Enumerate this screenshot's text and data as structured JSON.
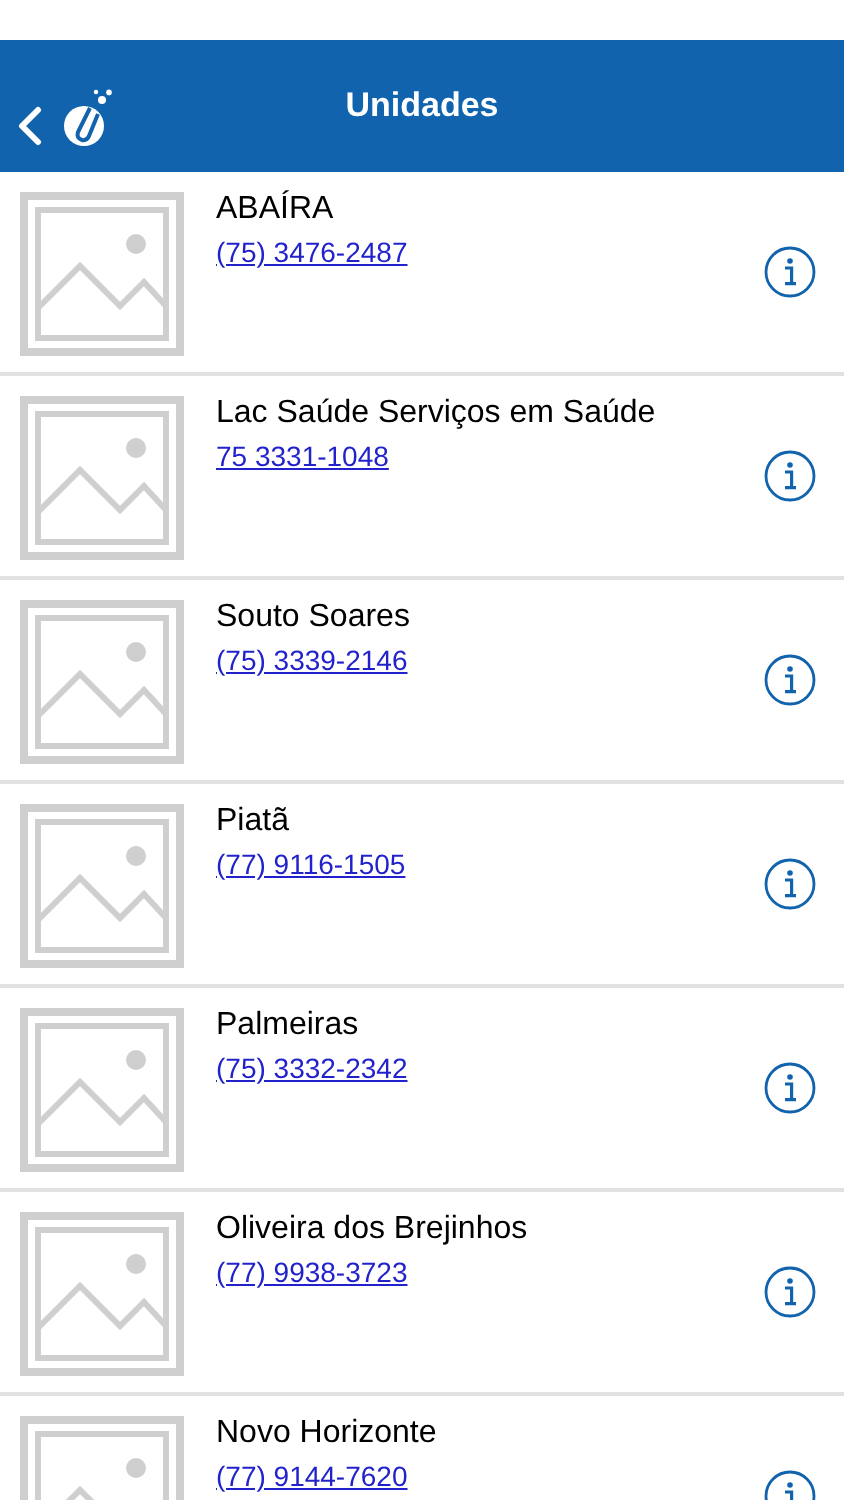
{
  "header": {
    "title": "Unidades"
  },
  "units": [
    {
      "name": "ABAÍRA",
      "phone": "(75) 3476-2487"
    },
    {
      "name": "Lac Saúde Serviços em Saúde",
      "phone": "75 3331-1048"
    },
    {
      "name": "Souto Soares",
      "phone": "(75) 3339-2146"
    },
    {
      "name": "Piatã",
      "phone": "(77) 9116-1505"
    },
    {
      "name": "Palmeiras",
      "phone": "(75) 3332-2342"
    },
    {
      "name": "Oliveira dos Brejinhos",
      "phone": "(77) 9938-3723"
    },
    {
      "name": "Novo Horizonte",
      "phone": "(77) 9144-7620"
    }
  ]
}
